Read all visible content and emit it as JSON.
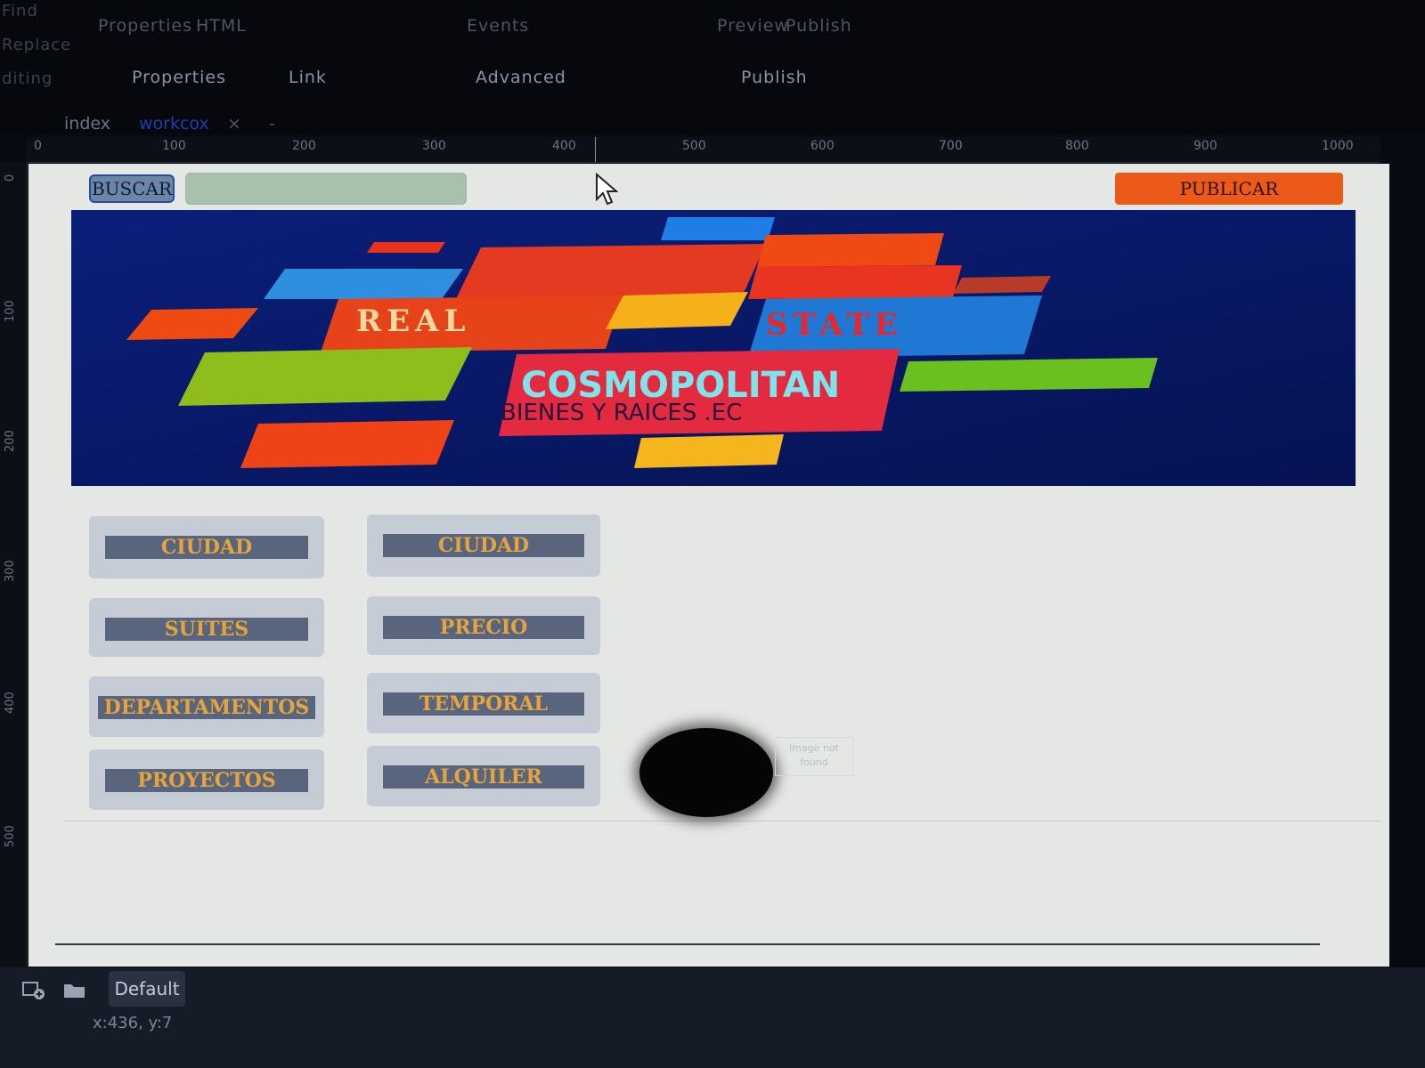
{
  "ribbon": {
    "side_items": [
      "Find",
      "Replace",
      "diting"
    ],
    "top_items": [
      "Properties",
      "HTML",
      "Events",
      "Preview",
      "Publish"
    ],
    "groups": [
      "Properties",
      "Link",
      "Advanced",
      "Publish"
    ]
  },
  "tabs": [
    {
      "label": "index",
      "active": false
    },
    {
      "label": "workcox",
      "active": true
    },
    {
      "label": "×",
      "active": false
    },
    {
      "label": "-",
      "active": false
    }
  ],
  "ruler": {
    "h_labels": [
      "0",
      "100",
      "200",
      "300",
      "400",
      "500",
      "600",
      "700",
      "800",
      "900",
      "1000"
    ],
    "v_labels": [
      "0",
      "100",
      "200",
      "300",
      "400",
      "500"
    ]
  },
  "page": {
    "search_button": "BUSCAR",
    "search_input_value": "",
    "publish_button": "PUBLICAR",
    "banner": {
      "word1": "REAL",
      "word2": "STATE",
      "brand": "COSMOPOLITAN",
      "tagline": "BIENES Y RAICES .EC"
    },
    "menu_left": [
      "CIUDAD",
      "SUITES",
      "DEPARTAMENTOS",
      "PROYECTOS"
    ],
    "menu_right": [
      "CIUDAD",
      "PRECIO",
      "TEMPORAL",
      "ALQUILER"
    ],
    "missing_image_text": "Image not found"
  },
  "statusbar": {
    "profile": "Default",
    "coordinates": "x:436, y:7"
  },
  "colors": {
    "canvas_bg": "#e4e7e3",
    "publish_orange": "#ec5a1a",
    "menu_label_bg": "#58657d",
    "menu_label_text": "#e7a43c",
    "banner_bg": "#0a1a6e"
  },
  "icons": [
    "cursor-arrow-icon",
    "add-page-icon",
    "folder-icon"
  ]
}
